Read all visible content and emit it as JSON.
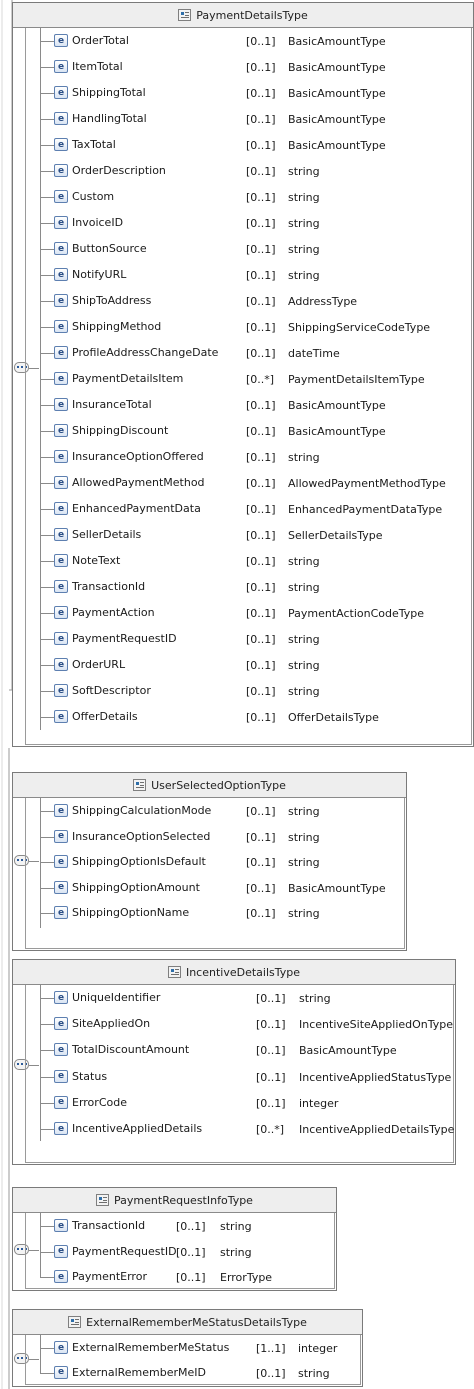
{
  "diagram": {
    "boxes": [
      {
        "title": "PaymentDetailsType",
        "elements": [
          {
            "name": "OrderTotal",
            "card": "[0..1]",
            "type": "BasicAmountType"
          },
          {
            "name": "ItemTotal",
            "card": "[0..1]",
            "type": "BasicAmountType"
          },
          {
            "name": "ShippingTotal",
            "card": "[0..1]",
            "type": "BasicAmountType"
          },
          {
            "name": "HandlingTotal",
            "card": "[0..1]",
            "type": "BasicAmountType"
          },
          {
            "name": "TaxTotal",
            "card": "[0..1]",
            "type": "BasicAmountType"
          },
          {
            "name": "OrderDescription",
            "card": "[0..1]",
            "type": "string"
          },
          {
            "name": "Custom",
            "card": "[0..1]",
            "type": "string"
          },
          {
            "name": "InvoiceID",
            "card": "[0..1]",
            "type": "string"
          },
          {
            "name": "ButtonSource",
            "card": "[0..1]",
            "type": "string"
          },
          {
            "name": "NotifyURL",
            "card": "[0..1]",
            "type": "string"
          },
          {
            "name": "ShipToAddress",
            "card": "[0..1]",
            "type": "AddressType"
          },
          {
            "name": "ShippingMethod",
            "card": "[0..1]",
            "type": "ShippingServiceCodeType"
          },
          {
            "name": "ProfileAddressChangeDate",
            "card": "[0..1]",
            "type": "dateTime"
          },
          {
            "name": "PaymentDetailsItem",
            "card": "[0..*]",
            "type": "PaymentDetailsItemType"
          },
          {
            "name": "InsuranceTotal",
            "card": "[0..1]",
            "type": "BasicAmountType"
          },
          {
            "name": "ShippingDiscount",
            "card": "[0..1]",
            "type": "BasicAmountType"
          },
          {
            "name": "InsuranceOptionOffered",
            "card": "[0..1]",
            "type": "string"
          },
          {
            "name": "AllowedPaymentMethod",
            "card": "[0..1]",
            "type": "AllowedPaymentMethodType"
          },
          {
            "name": "EnhancedPaymentData",
            "card": "[0..1]",
            "type": "EnhancedPaymentDataType"
          },
          {
            "name": "SellerDetails",
            "card": "[0..1]",
            "type": "SellerDetailsType"
          },
          {
            "name": "NoteText",
            "card": "[0..1]",
            "type": "string"
          },
          {
            "name": "TransactionId",
            "card": "[0..1]",
            "type": "string"
          },
          {
            "name": "PaymentAction",
            "card": "[0..1]",
            "type": "PaymentActionCodeType"
          },
          {
            "name": "PaymentRequestID",
            "card": "[0..1]",
            "type": "string"
          },
          {
            "name": "OrderURL",
            "card": "[0..1]",
            "type": "string"
          },
          {
            "name": "SoftDescriptor",
            "card": "[0..1]",
            "type": "string"
          },
          {
            "name": "OfferDetails",
            "card": "[0..1]",
            "type": "OfferDetailsType"
          }
        ]
      },
      {
        "title": "UserSelectedOptionType",
        "elements": [
          {
            "name": "ShippingCalculationMode",
            "card": "[0..1]",
            "type": "string"
          },
          {
            "name": "InsuranceOptionSelected",
            "card": "[0..1]",
            "type": "string"
          },
          {
            "name": "ShippingOptionIsDefault",
            "card": "[0..1]",
            "type": "string"
          },
          {
            "name": "ShippingOptionAmount",
            "card": "[0..1]",
            "type": "BasicAmountType"
          },
          {
            "name": "ShippingOptionName",
            "card": "[0..1]",
            "type": "string"
          }
        ]
      },
      {
        "title": "IncentiveDetailsType",
        "elements": [
          {
            "name": "UniqueIdentifier",
            "card": "[0..1]",
            "type": "string"
          },
          {
            "name": "SiteAppliedOn",
            "card": "[0..1]",
            "type": "IncentiveSiteAppliedOnType"
          },
          {
            "name": "TotalDiscountAmount",
            "card": "[0..1]",
            "type": "BasicAmountType"
          },
          {
            "name": "Status",
            "card": "[0..1]",
            "type": "IncentiveAppliedStatusType"
          },
          {
            "name": "ErrorCode",
            "card": "[0..1]",
            "type": "integer"
          },
          {
            "name": "IncentiveAppliedDetails",
            "card": "[0..*]",
            "type": "IncentiveAppliedDetailsType"
          }
        ]
      },
      {
        "title": "PaymentRequestInfoType",
        "elements": [
          {
            "name": "TransactionId",
            "card": "[0..1]",
            "type": "string"
          },
          {
            "name": "PaymentRequestID",
            "card": "[0..1]",
            "type": "string"
          },
          {
            "name": "PaymentError",
            "card": "[0..1]",
            "type": "ErrorType"
          }
        ]
      },
      {
        "title": "ExternalRememberMeStatusDetailsType",
        "elements": [
          {
            "name": "ExternalRememberMeStatus",
            "card": "[1..1]",
            "type": "integer"
          },
          {
            "name": "ExternalRememberMeID",
            "card": "[0..1]",
            "type": "string"
          }
        ]
      }
    ]
  }
}
